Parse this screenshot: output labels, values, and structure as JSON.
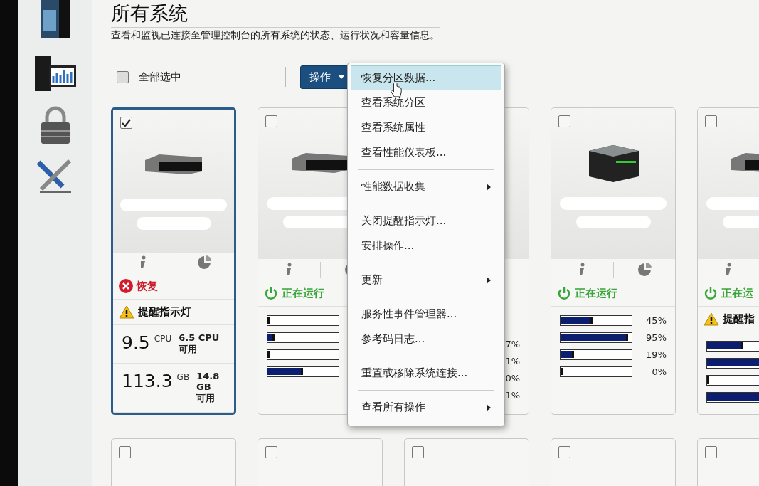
{
  "page": {
    "title": "所有系统",
    "description": "查看和监视已连接至管理控制台的所有系统的状态、运行状况和容量信息。"
  },
  "toolbar": {
    "select_all": {
      "label": "全部选中",
      "checked": false
    },
    "actions_button": {
      "label": "操作"
    }
  },
  "cards": [
    {
      "selected": true,
      "checked": true,
      "status": {
        "kind": "error",
        "label": "恢复"
      },
      "alert": {
        "label": "提醒指示灯"
      },
      "stats": [
        {
          "value": "9.5",
          "unit": "CPU",
          "available": "6.5 CPU",
          "available_label": "可用"
        },
        {
          "value": "113.3",
          "unit": "GB",
          "available": "14.8 GB",
          "available_label": "可用"
        }
      ]
    },
    {
      "selected": false,
      "checked": false,
      "status": {
        "kind": "running",
        "label": "正在运行"
      },
      "meters": [
        {
          "level": 0.03
        },
        {
          "level": 0.1
        },
        {
          "level": 0
        },
        {
          "level": 0.5
        }
      ]
    },
    {
      "selected": false,
      "meters": [
        {
          "reading": "7%"
        },
        {
          "reading": "1%"
        },
        {
          "reading": "0%"
        },
        {
          "reading": "1%"
        }
      ]
    },
    {
      "selected": false,
      "checked": false,
      "status": {
        "kind": "running",
        "label": "正在运行"
      },
      "meters": [
        {
          "level": 0.45,
          "reading": "45%"
        },
        {
          "level": 0.95,
          "reading": "95%"
        },
        {
          "level": 0.19,
          "reading": "19%"
        },
        {
          "level": 0,
          "reading": "0%"
        }
      ]
    },
    {
      "selected": false,
      "checked": false,
      "status": {
        "kind": "running",
        "label": "正在运"
      },
      "alert": {
        "label": "提醒指"
      },
      "meters": [
        {
          "level": 0.5
        },
        {
          "level": 1
        },
        {
          "level": 0
        },
        {
          "level": 1
        }
      ]
    }
  ],
  "bottom_cards": [
    {
      "checked": false
    },
    {
      "checked": false
    },
    {
      "checked": false
    },
    {
      "checked": false
    },
    {
      "checked": false
    }
  ],
  "menu": [
    {
      "kind": "item",
      "label": "恢复分区数据...",
      "selected": true
    },
    {
      "kind": "item",
      "label": "查看系统分区",
      "selected": false
    },
    {
      "kind": "item",
      "label": "查看系统属性",
      "selected": false
    },
    {
      "kind": "item",
      "label": "查看性能仪表板...",
      "selected": false
    },
    {
      "kind": "separator"
    },
    {
      "kind": "submenu",
      "label": "性能数据收集",
      "selected": false
    },
    {
      "kind": "separator"
    },
    {
      "kind": "item",
      "label": "关闭提醒指示灯...",
      "selected": false
    },
    {
      "kind": "item",
      "label": "安排操作...",
      "selected": false
    },
    {
      "kind": "separator"
    },
    {
      "kind": "submenu",
      "label": "更新",
      "selected": false
    },
    {
      "kind": "separator"
    },
    {
      "kind": "item",
      "label": "服务性事件管理器...",
      "selected": false
    },
    {
      "kind": "item",
      "label": "参考码日志...",
      "selected": false
    },
    {
      "kind": "separator"
    },
    {
      "kind": "item",
      "label": "重置或移除系统连接...",
      "selected": false
    },
    {
      "kind": "separator"
    },
    {
      "kind": "submenu",
      "label": "查看所有操作",
      "selected": false
    }
  ]
}
